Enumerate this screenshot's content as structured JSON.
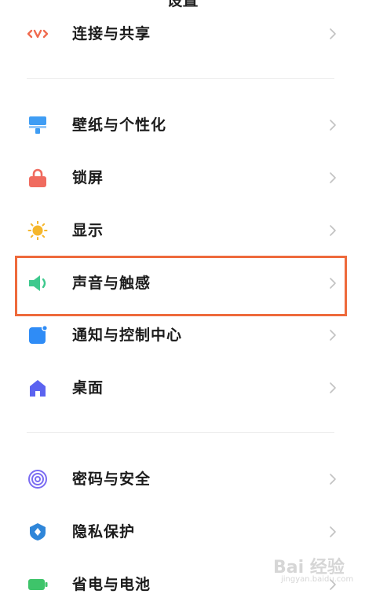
{
  "header": {
    "title": "设置"
  },
  "settings": {
    "items": [
      {
        "label": "连接与共享",
        "icon": "connection-share-icon",
        "color": "#f06b4f"
      },
      {
        "label": "壁纸与个性化",
        "icon": "wallpaper-brush-icon",
        "color": "#3f9df4"
      },
      {
        "label": "锁屏",
        "icon": "lock-icon",
        "color": "#f06b5f"
      },
      {
        "label": "显示",
        "icon": "sun-icon",
        "color": "#f5b62b"
      },
      {
        "label": "声音与触感",
        "icon": "speaker-icon",
        "color": "#3ec98e"
      },
      {
        "label": "通知与控制中心",
        "icon": "notification-icon",
        "color": "#2f8cf6"
      },
      {
        "label": "桌面",
        "icon": "home-icon",
        "color": "#5b63f0"
      },
      {
        "label": "密码与安全",
        "icon": "fingerprint-icon",
        "color": "#7b6cf2"
      },
      {
        "label": "隐私保护",
        "icon": "privacy-shield-icon",
        "color": "#2f86d9"
      },
      {
        "label": "省电与电池",
        "icon": "battery-icon",
        "color": "#3ec46a"
      }
    ],
    "highlighted_item": "声音与触感"
  },
  "watermark": {
    "text": "Bai 经验",
    "sub": "jingyan.baidu.com"
  }
}
